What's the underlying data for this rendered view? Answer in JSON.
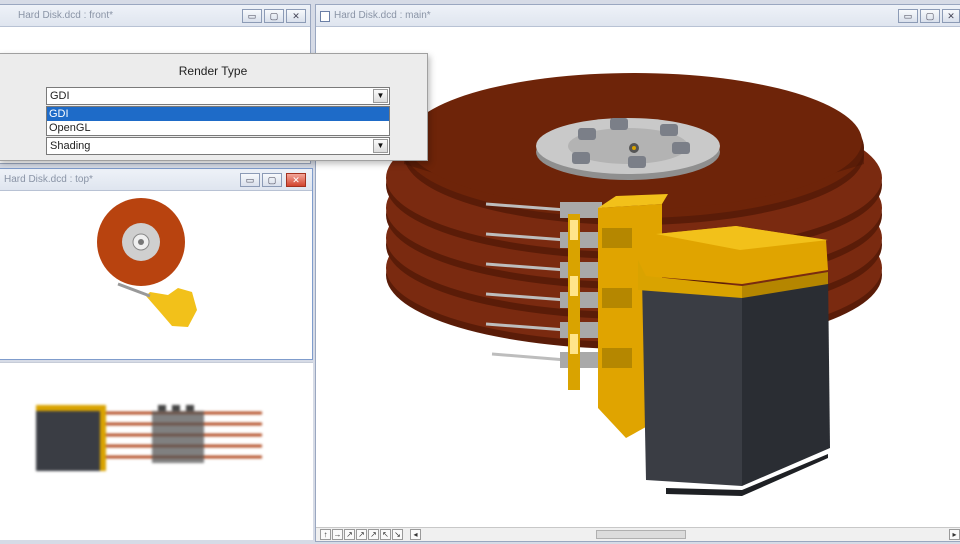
{
  "windows": {
    "front": {
      "title": "Hard Disk.dcd : front*"
    },
    "top": {
      "title": "Hard Disk.dcd : top*"
    },
    "main": {
      "title": "Hard Disk.dcd : main*"
    }
  },
  "window_buttons": {
    "minimize": "▭",
    "restore": "▢",
    "close": "✕"
  },
  "dialog": {
    "title": "Render Type",
    "render_combo_value": "GDI",
    "options": [
      "GDI",
      "OpenGL"
    ],
    "selected_option": "GDI",
    "shading_combo_value": "Shading",
    "arrow": "▼"
  },
  "strip_buttons": [
    "↑",
    "→",
    "↗",
    "↗",
    "↗",
    "↖",
    "↘",
    "◂"
  ],
  "strip_right_arrow": "▸",
  "colors": {
    "platter": "#7a2a10",
    "platter_edge": "#5a1c08",
    "gold": "#e0a400",
    "actuator_dark": "#2f333b",
    "selection": "#1e6bc8"
  }
}
